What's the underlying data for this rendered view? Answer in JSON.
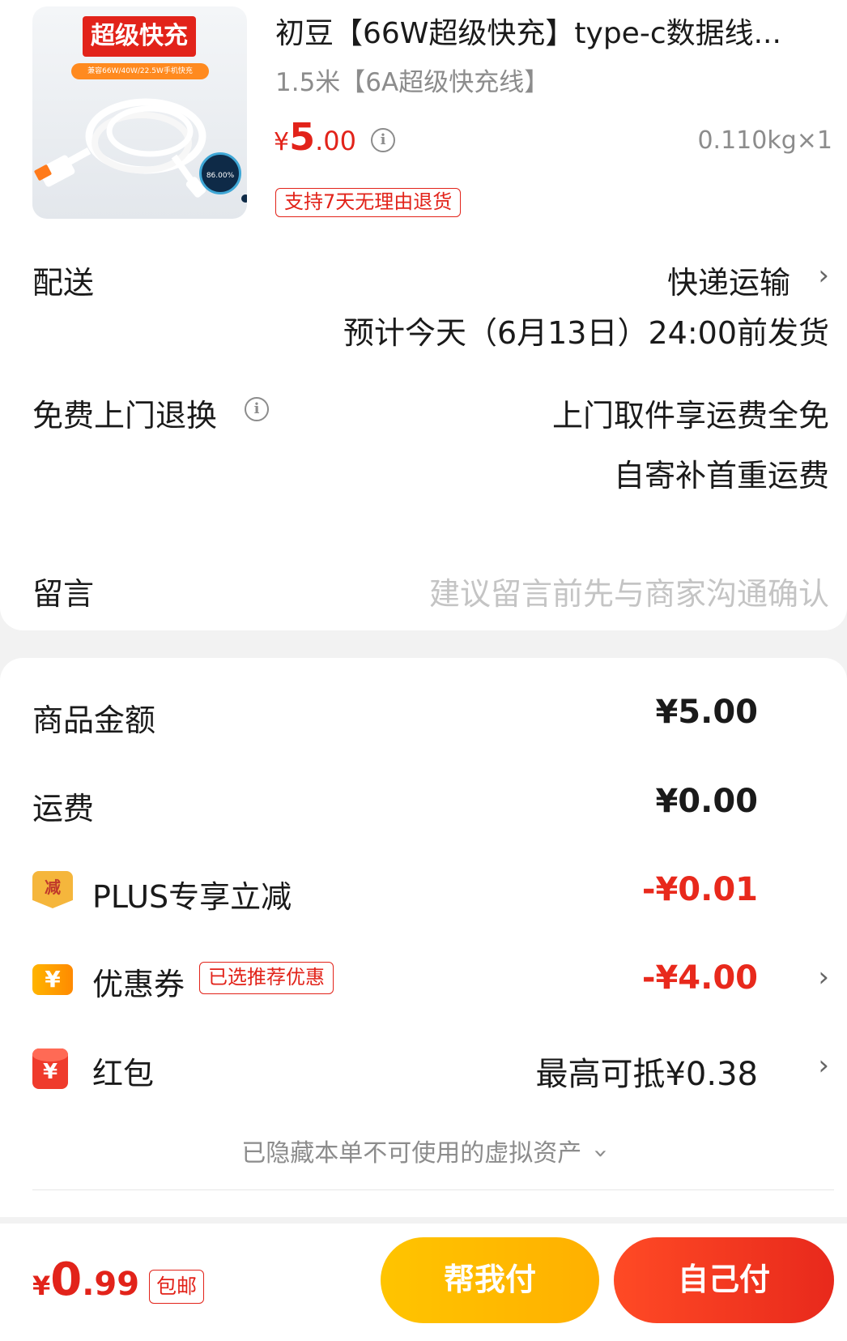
{
  "product": {
    "image_banner": "超级快充",
    "image_subbanner": "兼容66W/40W/22.5W手机快充",
    "image_gauge": "86.00%",
    "title": "初豆【66W超级快充】type-c数据线...",
    "spec": "1.5米【6A超级快充线】",
    "price_currency": "¥",
    "price_int": "5",
    "price_dec": ".00",
    "weight_qty": "0.110kg×1",
    "return_tag": "支持7天无理由退货"
  },
  "delivery": {
    "label": "配送",
    "method": "快递运输",
    "estimate": "预计今天（6月13日）24:00前发货"
  },
  "return_service": {
    "label": "免费上门退换",
    "line1": "上门取件享运费全免",
    "line2": "自寄补首重运费"
  },
  "message": {
    "label": "留言",
    "placeholder": "建议留言前先与商家沟通确认"
  },
  "summary": {
    "goods_label": "商品金额",
    "goods_value": "¥5.00",
    "shipping_label": "运费",
    "shipping_value": "¥0.00",
    "plus_icon": "减",
    "plus_label": "PLUS专享立减",
    "plus_value": "-¥0.01",
    "coupon_icon": "¥",
    "coupon_label": "优惠券",
    "coupon_tag": "已选推荐优惠",
    "coupon_value": "-¥4.00",
    "redpack_icon": "¥",
    "redpack_label": "红包",
    "redpack_value": "最高可抵¥0.38",
    "hidden_assets": "已隐藏本单不可使用的虚拟资产"
  },
  "bottom": {
    "total_currency": "¥",
    "total_int": "0",
    "total_dec": ".99",
    "free_shipping": "包邮",
    "help_pay": "帮我付",
    "self_pay": "自己付"
  },
  "colors": {
    "accent_red": "#e2231a",
    "help_yellow": "#ffc400",
    "muted_gray": "#8c8c8c"
  },
  "icons": [
    "info-icon",
    "chevron-right-icon",
    "chevron-down-icon",
    "plus-discount-icon",
    "coupon-icon",
    "red-packet-icon"
  ]
}
